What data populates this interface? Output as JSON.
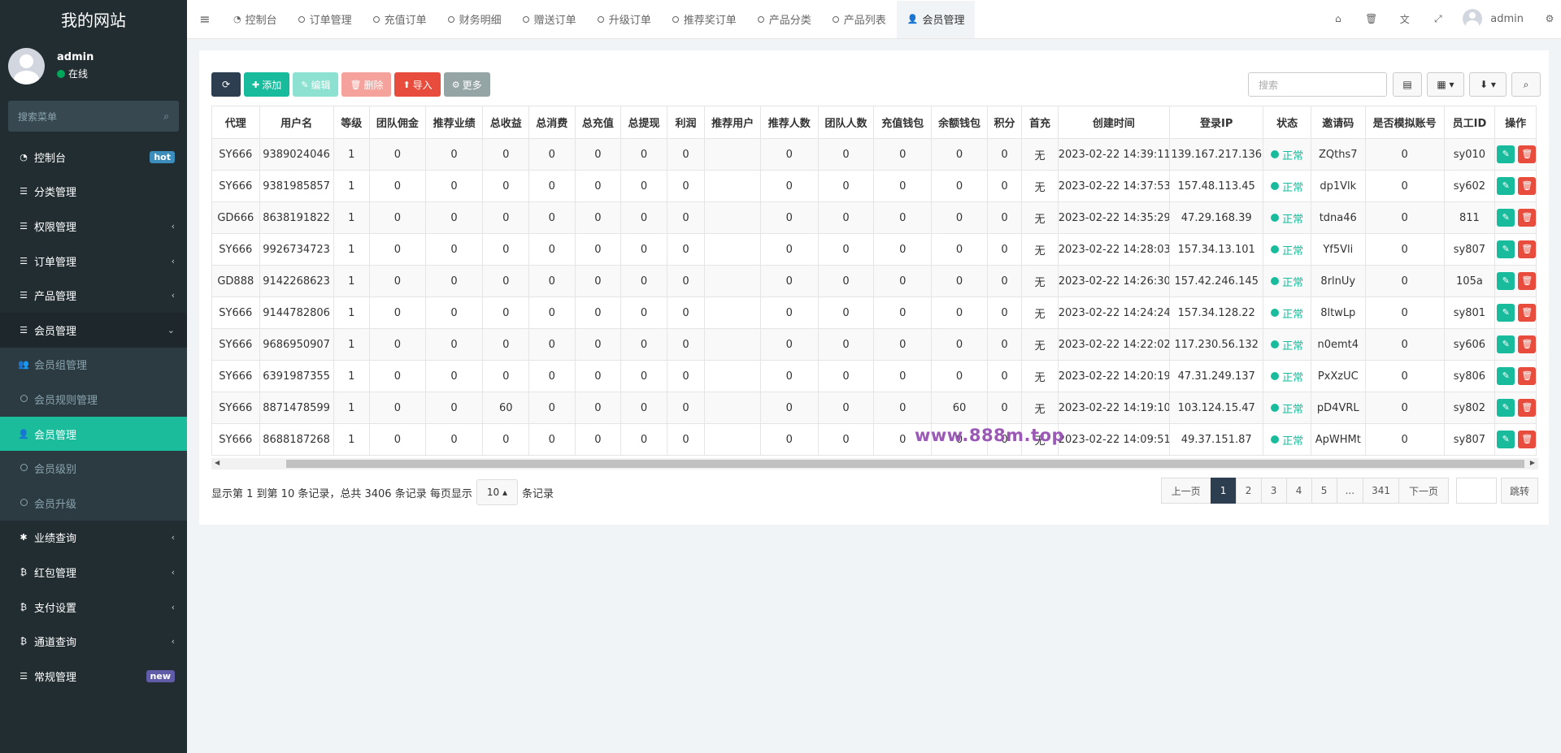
{
  "sidebar": {
    "site_title": "我的网站",
    "user": {
      "name": "admin",
      "status": "在线"
    },
    "search_placeholder": "搜索菜单",
    "items": [
      {
        "icon": "dashboard-icon",
        "label": "控制台",
        "badge": "hot"
      },
      {
        "icon": "list-icon",
        "label": "分类管理"
      },
      {
        "icon": "list-icon",
        "label": "权限管理"
      },
      {
        "icon": "list-icon",
        "label": "订单管理"
      },
      {
        "icon": "list-icon",
        "label": "产品管理"
      },
      {
        "icon": "list-icon",
        "label": "会员管理"
      }
    ],
    "sub_items": [
      {
        "icon": "users-icon",
        "label": "会员组管理"
      },
      {
        "icon": "circle-icon",
        "label": "会员规则管理"
      },
      {
        "icon": "user-icon",
        "label": "会员管理",
        "active": true
      },
      {
        "icon": "circle-icon",
        "label": "会员级别"
      },
      {
        "icon": "circle-icon",
        "label": "会员升级"
      }
    ],
    "items_after": [
      {
        "icon": "asterisk-icon",
        "label": "业绩查询"
      },
      {
        "icon": "bitcoin-icon",
        "label": "红包管理"
      },
      {
        "icon": "bitcoin-icon",
        "label": "支付设置"
      },
      {
        "icon": "bitcoin-icon",
        "label": "通道查询"
      },
      {
        "icon": "list-icon",
        "label": "常规管理",
        "badge": "new"
      }
    ]
  },
  "topbar": {
    "tabs": [
      "控制台",
      "订单管理",
      "充值订单",
      "财务明细",
      "赠送订单",
      "升级订单",
      "推荐奖订单",
      "产品分类",
      "产品列表",
      "会员管理"
    ],
    "user_name": "admin"
  },
  "toolbar": {
    "add": "添加",
    "edit": "编辑",
    "delete": "删除",
    "import": "导入",
    "more": "更多",
    "search_placeholder": "搜索"
  },
  "table": {
    "headers": [
      "代理",
      "用户名",
      "等级",
      "团队佣金",
      "推荐业绩",
      "总收益",
      "总消费",
      "总充值",
      "总提现",
      "利润",
      "推荐用户",
      "推荐人数",
      "团队人数",
      "充值钱包",
      "余额钱包",
      "积分",
      "首充",
      "创建时间",
      "登录IP",
      "状态",
      "邀请码",
      "是否模拟账号",
      "员工ID",
      "操作"
    ],
    "rows": [
      [
        "SY666",
        "9389024046",
        "1",
        "0",
        "0",
        "0",
        "0",
        "0",
        "0",
        "0",
        "",
        "0",
        "0",
        "0",
        "0",
        "0",
        "无",
        "2023-02-22 14:39:11",
        "139.167.217.136",
        "正常",
        "ZQths7",
        "0",
        "sy010"
      ],
      [
        "SY666",
        "9381985857",
        "1",
        "0",
        "0",
        "0",
        "0",
        "0",
        "0",
        "0",
        "",
        "0",
        "0",
        "0",
        "0",
        "0",
        "无",
        "2023-02-22 14:37:53",
        "157.48.113.45",
        "正常",
        "dp1Vlk",
        "0",
        "sy602"
      ],
      [
        "GD666",
        "8638191822",
        "1",
        "0",
        "0",
        "0",
        "0",
        "0",
        "0",
        "0",
        "",
        "0",
        "0",
        "0",
        "0",
        "0",
        "无",
        "2023-02-22 14:35:29",
        "47.29.168.39",
        "正常",
        "tdna46",
        "0",
        "811"
      ],
      [
        "SY666",
        "9926734723",
        "1",
        "0",
        "0",
        "0",
        "0",
        "0",
        "0",
        "0",
        "",
        "0",
        "0",
        "0",
        "0",
        "0",
        "无",
        "2023-02-22 14:28:03",
        "157.34.13.101",
        "正常",
        "Yf5Vli",
        "0",
        "sy807"
      ],
      [
        "GD888",
        "9142268623",
        "1",
        "0",
        "0",
        "0",
        "0",
        "0",
        "0",
        "0",
        "",
        "0",
        "0",
        "0",
        "0",
        "0",
        "无",
        "2023-02-22 14:26:30",
        "157.42.246.145",
        "正常",
        "8rlnUy",
        "0",
        "105a"
      ],
      [
        "SY666",
        "9144782806",
        "1",
        "0",
        "0",
        "0",
        "0",
        "0",
        "0",
        "0",
        "",
        "0",
        "0",
        "0",
        "0",
        "0",
        "无",
        "2023-02-22 14:24:24",
        "157.34.128.22",
        "正常",
        "8ltwLp",
        "0",
        "sy801"
      ],
      [
        "SY666",
        "9686950907",
        "1",
        "0",
        "0",
        "0",
        "0",
        "0",
        "0",
        "0",
        "",
        "0",
        "0",
        "0",
        "0",
        "0",
        "无",
        "2023-02-22 14:22:02",
        "117.230.56.132",
        "正常",
        "n0emt4",
        "0",
        "sy606"
      ],
      [
        "SY666",
        "6391987355",
        "1",
        "0",
        "0",
        "0",
        "0",
        "0",
        "0",
        "0",
        "",
        "0",
        "0",
        "0",
        "0",
        "0",
        "无",
        "2023-02-22 14:20:19",
        "47.31.249.137",
        "正常",
        "PxXzUC",
        "0",
        "sy806"
      ],
      [
        "SY666",
        "8871478599",
        "1",
        "0",
        "0",
        "60",
        "0",
        "0",
        "0",
        "0",
        "",
        "0",
        "0",
        "0",
        "60",
        "0",
        "无",
        "2023-02-22 14:19:10",
        "103.124.15.47",
        "正常",
        "pD4VRL",
        "0",
        "sy802"
      ],
      [
        "SY666",
        "8688187268",
        "1",
        "0",
        "0",
        "0",
        "0",
        "0",
        "0",
        "0",
        "",
        "0",
        "0",
        "0",
        "0",
        "0",
        "无",
        "2023-02-22 14:09:51",
        "49.37.151.87",
        "正常",
        "ApWHMt",
        "0",
        "sy807"
      ]
    ]
  },
  "footer": {
    "info_prefix": "显示第 1 到第 10 条记录，总共 3406 条记录 每页显示",
    "page_size": "10",
    "info_suffix": "条记录"
  },
  "pagination": {
    "prev": "上一页",
    "pages": [
      "1",
      "2",
      "3",
      "4",
      "5",
      "...",
      "341"
    ],
    "current": "1",
    "next": "下一页",
    "jump": "跳转"
  },
  "watermark": "www.888m.top",
  "colors": {
    "primary": "#18bc9c",
    "dark": "#2c3e50",
    "danger": "#e74c3c",
    "sidebar": "#222d32"
  }
}
